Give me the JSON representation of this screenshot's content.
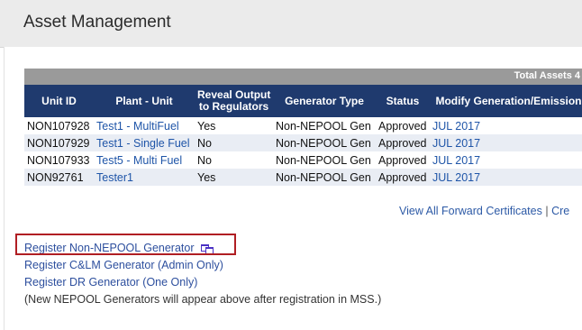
{
  "page": {
    "title": "Asset Management"
  },
  "summary": {
    "total_assets": "Total Assets 4"
  },
  "table": {
    "headers": {
      "unit_id": "Unit ID",
      "plant_unit": "Plant - Unit",
      "reveal_line1": "Reveal Output",
      "reveal_line2": "to Regulators",
      "generator_type": "Generator Type",
      "status": "Status",
      "modify": "Modify Generation/Emission"
    },
    "rows": [
      {
        "unit_id": "NON107928",
        "plant_unit": "Test1 - MultiFuel",
        "reveal": "Yes",
        "generator_type": "Non-NEPOOL Gen",
        "status": "Approved",
        "modify": "JUL 2017"
      },
      {
        "unit_id": "NON107929",
        "plant_unit": "Test1 - Single Fuel",
        "reveal": "No",
        "generator_type": "Non-NEPOOL Gen",
        "status": "Approved",
        "modify": "JUL 2017"
      },
      {
        "unit_id": "NON107933",
        "plant_unit": "Test5 - Multi Fuel",
        "reveal": "No",
        "generator_type": "Non-NEPOOL Gen",
        "status": "Approved",
        "modify": "JUL 2017"
      },
      {
        "unit_id": "NON92761",
        "plant_unit": "Tester1",
        "reveal": "Yes",
        "generator_type": "Non-NEPOOL Gen",
        "status": "Approved",
        "modify": "JUL 2017"
      }
    ]
  },
  "links": {
    "view_forward": "View All Forward Certificates",
    "separator": "|",
    "create_cut": "Cre"
  },
  "register": {
    "non_nepool": "Register Non-NEPOOL Generator",
    "clm": "Register C&LM Generator (Admin Only)",
    "dr": "Register DR Generator (One Only)",
    "note": "(New NEPOOL Generators will appear above after registration in MSS.)"
  },
  "icons": {
    "new_window": "new-window-icon"
  },
  "colors": {
    "header_bg": "#1f3a6e",
    "link": "#2d4f9e",
    "highlight": "#b01e23",
    "total_bar": "#9a9a9a"
  }
}
